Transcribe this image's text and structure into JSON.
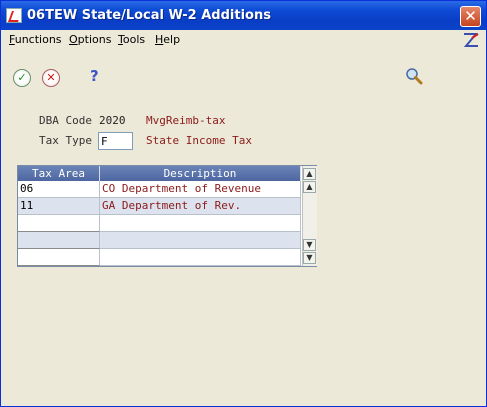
{
  "window": {
    "title": "06TEW   State/Local W-2 Additions",
    "close_glyph": "✕"
  },
  "menu": {
    "items": [
      {
        "underline": "F",
        "rest": "unctions"
      },
      {
        "underline": "O",
        "rest": "ptions"
      },
      {
        "underline": "T",
        "rest": "ools"
      },
      {
        "underline": "H",
        "rest": "elp"
      }
    ]
  },
  "toolbar": {
    "ok_glyph": "✓",
    "cancel_glyph": "✕",
    "help_glyph": "?"
  },
  "form": {
    "dba_code_label": "DBA Code",
    "dba_code_value": "2020",
    "dba_code_desc": "MvgReimb-tax",
    "tax_type_label": "Tax Type",
    "tax_type_value": "F",
    "tax_type_desc": "State Income Tax"
  },
  "grid": {
    "columns": [
      "Tax Area",
      "Description"
    ],
    "rows": [
      {
        "tax_area": "06",
        "description": "CO Department of Revenue"
      },
      {
        "tax_area": "11",
        "description": "GA Department of Rev."
      },
      {
        "tax_area": "",
        "description": ""
      },
      {
        "tax_area": "",
        "description": ""
      },
      {
        "tax_area": "",
        "description": ""
      }
    ],
    "scroll_up_glyph": "▲",
    "scroll_down_glyph": "▼"
  }
}
